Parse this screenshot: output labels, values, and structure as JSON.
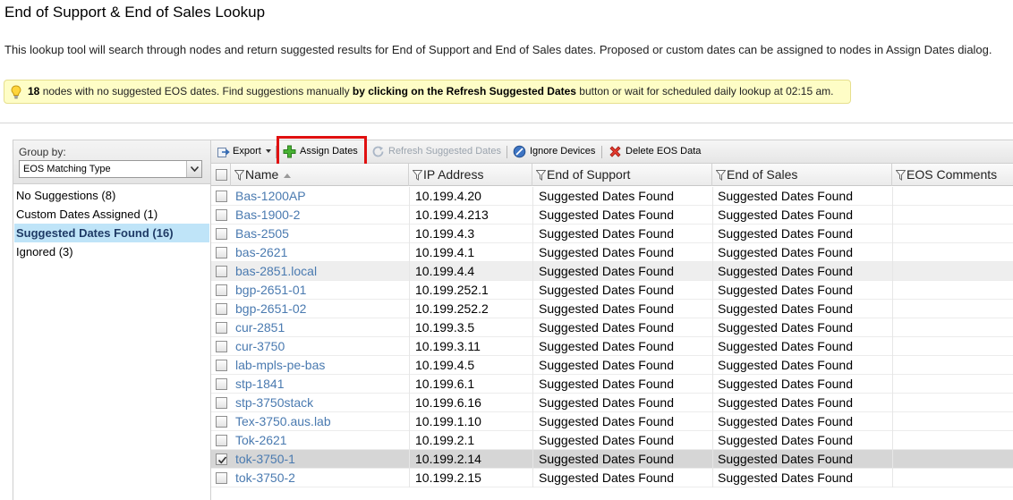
{
  "page": {
    "title": "End of Support & End of Sales Lookup",
    "description": "This lookup tool will search through nodes and return suggested results for End of Support and End of Sales dates. Proposed or custom dates can be assigned to nodes in Assign Dates dialog."
  },
  "hint": {
    "count": "18",
    "text_part1": " nodes with no suggested EOS dates. Find suggestions manually ",
    "bold_part": "by clicking on the Refresh Suggested Dates",
    "text_part2": " button or wait for scheduled daily lookup at 02:15 am."
  },
  "group_panel": {
    "label": "Group by:",
    "selected": "EOS Matching Type",
    "items": [
      {
        "label": "No Suggestions (8)"
      },
      {
        "label": "Custom Dates Assigned (1)"
      },
      {
        "label": "Suggested Dates Found (16)"
      },
      {
        "label": "Ignored (3)"
      }
    ]
  },
  "toolbar": {
    "export": "Export",
    "assign_dates": "Assign Dates",
    "refresh": "Refresh Suggested Dates",
    "ignore": "Ignore Devices",
    "delete": "Delete EOS Data"
  },
  "grid": {
    "columns": [
      "Name",
      "IP Address",
      "End of Support",
      "End of Sales",
      "EOS Comments"
    ],
    "rows": [
      {
        "name": "Bas-1200AP",
        "ip": "10.199.4.20",
        "eosupport": "Suggested Dates Found",
        "eosales": "Suggested Dates Found",
        "comments": ""
      },
      {
        "name": "Bas-1900-2",
        "ip": "10.199.4.213",
        "eosupport": "Suggested Dates Found",
        "eosales": "Suggested Dates Found",
        "comments": ""
      },
      {
        "name": "Bas-2505",
        "ip": "10.199.4.3",
        "eosupport": "Suggested Dates Found",
        "eosales": "Suggested Dates Found",
        "comments": ""
      },
      {
        "name": "bas-2621",
        "ip": "10.199.4.1",
        "eosupport": "Suggested Dates Found",
        "eosales": "Suggested Dates Found",
        "comments": ""
      },
      {
        "name": "bas-2851.local",
        "ip": "10.199.4.4",
        "eosupport": "Suggested Dates Found",
        "eosales": "Suggested Dates Found",
        "comments": ""
      },
      {
        "name": "bgp-2651-01",
        "ip": "10.199.252.1",
        "eosupport": "Suggested Dates Found",
        "eosales": "Suggested Dates Found",
        "comments": ""
      },
      {
        "name": "bgp-2651-02",
        "ip": "10.199.252.2",
        "eosupport": "Suggested Dates Found",
        "eosales": "Suggested Dates Found",
        "comments": ""
      },
      {
        "name": "cur-2851",
        "ip": "10.199.3.5",
        "eosupport": "Suggested Dates Found",
        "eosales": "Suggested Dates Found",
        "comments": ""
      },
      {
        "name": "cur-3750",
        "ip": "10.199.3.11",
        "eosupport": "Suggested Dates Found",
        "eosales": "Suggested Dates Found",
        "comments": ""
      },
      {
        "name": "lab-mpls-pe-bas",
        "ip": "10.199.4.5",
        "eosupport": "Suggested Dates Found",
        "eosales": "Suggested Dates Found",
        "comments": ""
      },
      {
        "name": "stp-1841",
        "ip": "10.199.6.1",
        "eosupport": "Suggested Dates Found",
        "eosales": "Suggested Dates Found",
        "comments": ""
      },
      {
        "name": "stp-3750stack",
        "ip": "10.199.6.16",
        "eosupport": "Suggested Dates Found",
        "eosales": "Suggested Dates Found",
        "comments": ""
      },
      {
        "name": "Tex-3750.aus.lab",
        "ip": "10.199.1.10",
        "eosupport": "Suggested Dates Found",
        "eosales": "Suggested Dates Found",
        "comments": ""
      },
      {
        "name": "Tok-2621",
        "ip": "10.199.2.1",
        "eosupport": "Suggested Dates Found",
        "eosales": "Suggested Dates Found",
        "comments": ""
      },
      {
        "name": "tok-3750-1",
        "ip": "10.199.2.14",
        "eosupport": "Suggested Dates Found",
        "eosales": "Suggested Dates Found",
        "comments": "",
        "checked": true
      },
      {
        "name": "tok-3750-2",
        "ip": "10.199.2.15",
        "eosupport": "Suggested Dates Found",
        "eosales": "Suggested Dates Found",
        "comments": ""
      }
    ]
  },
  "colors": {
    "link": "#4a7ab0",
    "highlight_border": "#e01010",
    "hint_bg": "#fefdc6",
    "selected_group_bg": "#bfe4f8"
  }
}
